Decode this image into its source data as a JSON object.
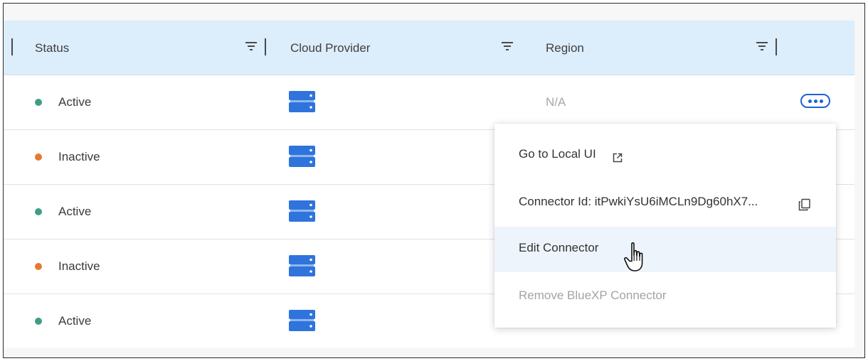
{
  "columns": [
    {
      "label": "Status"
    },
    {
      "label": "Cloud Provider"
    },
    {
      "label": "Region"
    }
  ],
  "rows": [
    {
      "status": "Active",
      "status_color": "#3f9d86",
      "region": "N/A"
    },
    {
      "status": "Inactive",
      "status_color": "#e8782e",
      "region": ""
    },
    {
      "status": "Active",
      "status_color": "#3f9d86",
      "region": ""
    },
    {
      "status": "Inactive",
      "status_color": "#e8782e",
      "region": ""
    },
    {
      "status": "Active",
      "status_color": "#3f9d86",
      "region": ""
    }
  ],
  "row_actions": {
    "icon": "more-options-icon"
  },
  "context_menu": {
    "items": [
      {
        "label": "Go to Local UI",
        "icon": "external-link-icon",
        "state": "normal"
      },
      {
        "label": "Connector Id: itPwkiYsU6iMCLn9Dg60hX7...",
        "icon": "copy-icon",
        "state": "normal"
      },
      {
        "label": "Edit Connector",
        "state": "hover"
      },
      {
        "label": "Remove BlueXP Connector",
        "state": "disabled"
      }
    ]
  },
  "colors": {
    "header_bg": "#dcedfb",
    "accent": "#1e63d4",
    "server_icon": "#2f73dc",
    "active": "#3f9d86",
    "inactive": "#e8782e"
  }
}
